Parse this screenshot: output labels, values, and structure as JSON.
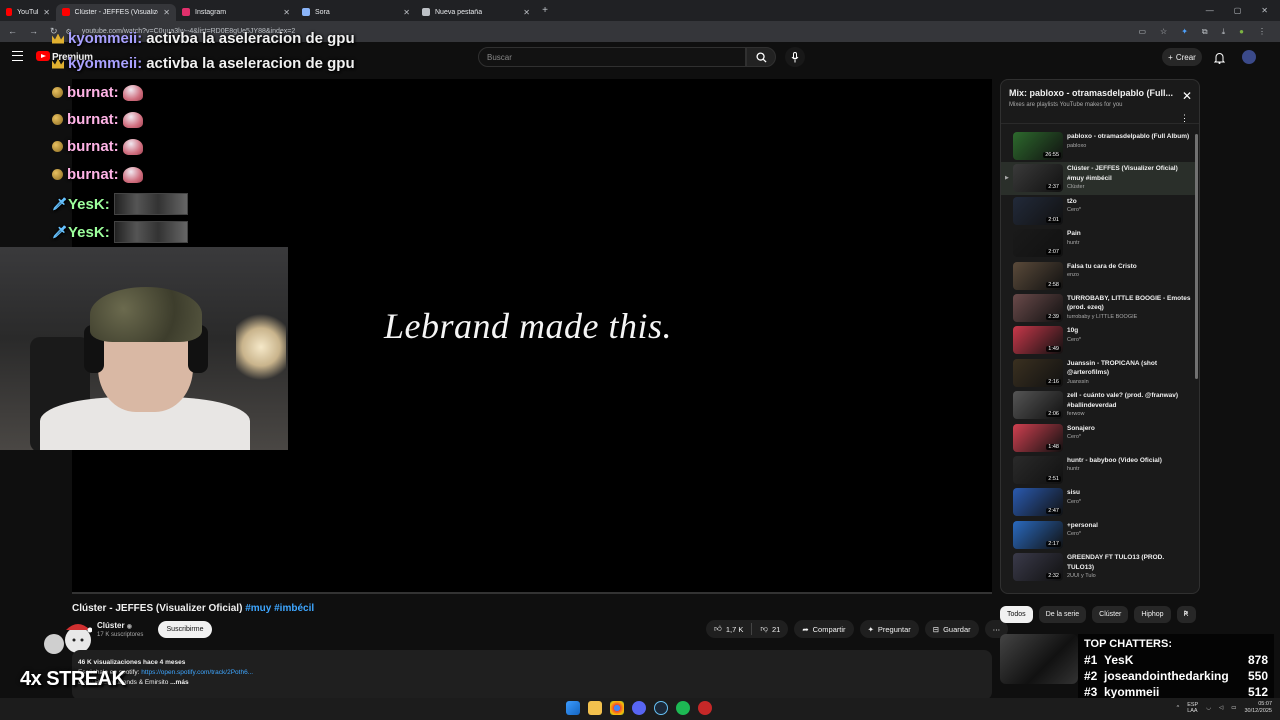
{
  "browser": {
    "tabs": [
      {
        "label": "YouTube",
        "color": "#ff0000",
        "active": false
      },
      {
        "label": "Clúster - JEFFES (Visualizer",
        "color": "#ff0000",
        "active": true
      },
      {
        "label": "Instagram",
        "color": "#e1306c",
        "active": false
      },
      {
        "label": "Sora",
        "color": "#8ab4f8",
        "active": false
      },
      {
        "label": "Nueva pestaña",
        "color": "#bdc1c6",
        "active": false
      }
    ],
    "url": "youtube.com/watch?v=C0uua3lw--4&list=RD0E8gUe5JY88&index=2"
  },
  "header": {
    "brand": "Premium",
    "search_placeholder": "Buscar",
    "create_label": "Crear"
  },
  "player": {
    "overlay_text": "Lebrand made this."
  },
  "chat": [
    {
      "badge": "crown",
      "name": "kyommeii",
      "color": "#a9a1ff",
      "message": "activba la aseleracion de gpu",
      "emote": null
    },
    {
      "badge": "crown",
      "name": "kyommeii",
      "color": "#a9a1ff",
      "message": "activba la aseleracion de gpu",
      "emote": null
    },
    {
      "badge": "coin",
      "name": "burnat",
      "color": "#ffb3e6",
      "message": "",
      "emote": "mushroom"
    },
    {
      "badge": "coin",
      "name": "burnat",
      "color": "#ffb3e6",
      "message": "",
      "emote": "mushroom"
    },
    {
      "badge": "coin",
      "name": "burnat",
      "color": "#ffb3e6",
      "message": "",
      "emote": "mushroom"
    },
    {
      "badge": "coin",
      "name": "burnat",
      "color": "#ffb3e6",
      "message": "",
      "emote": "mushroom"
    },
    {
      "badge": "sword",
      "name": "YesK",
      "color": "#9cff9c",
      "message": "",
      "emote": "image"
    },
    {
      "badge": "sword",
      "name": "YesK",
      "color": "#9cff9c",
      "message": "",
      "emote": "image"
    }
  ],
  "playlist": {
    "title": "Mix: pabloxo - otramasdelpablo (Full...",
    "subtitle": "Mixes are playlists YouTube makes for you",
    "items": [
      {
        "title": "pabloxo - otramasdelpablo (Full Album)",
        "artist": "pabloxo",
        "duration": "26:55",
        "active": false,
        "thumb": "#2d6a2d"
      },
      {
        "title": "Clúster - JEFFES (Visualizer Oficial) #muy #imbécil",
        "artist": "Clúster",
        "duration": "2:37",
        "active": true,
        "thumb": "#3a3a3a"
      },
      {
        "title": "t2o",
        "artist": "Cero*",
        "duration": "2:01",
        "active": false,
        "thumb": "#222a3a"
      },
      {
        "title": "Pain",
        "artist": "huntr",
        "duration": "2:07",
        "active": false,
        "thumb": "#1a1a1a"
      },
      {
        "title": "Falsa tu cara de Cristo",
        "artist": "enzo",
        "duration": "2:58",
        "active": false,
        "thumb": "#5a4a3a"
      },
      {
        "title": "TURROBABY, LITTLE BOOGIE - Emotes (prod. ezeq)",
        "artist": "turrobaby y LITTLE BOOGIE",
        "duration": "2:39",
        "active": false,
        "thumb": "#6a4a4a"
      },
      {
        "title": "10g",
        "artist": "Cero*",
        "duration": "1:49",
        "active": false,
        "thumb": "#c8384a"
      },
      {
        "title": "Juanssin - TROPICANA (shot @arterofilms)",
        "artist": "Juanssin",
        "duration": "2:16",
        "active": false,
        "thumb": "#3a3020"
      },
      {
        "title": "zell - cuánto vale? (prod. @franwav) #ballindeverdad",
        "artist": "ferwow",
        "duration": "2:06",
        "active": false,
        "thumb": "#555555"
      },
      {
        "title": "Sonajero",
        "artist": "Cero*",
        "duration": "1:48",
        "active": false,
        "thumb": "#d04050"
      },
      {
        "title": "huntr - babyboo (Video Oficial)",
        "artist": "huntr",
        "duration": "2:51",
        "active": false,
        "thumb": "#2a2a2a"
      },
      {
        "title": "sisu",
        "artist": "Cero*",
        "duration": "2:47",
        "active": false,
        "thumb": "#2a5ab0"
      },
      {
        "title": "+personal",
        "artist": "Cero*",
        "duration": "2:17",
        "active": false,
        "thumb": "#2a6ac0"
      },
      {
        "title": "GREENDAY FT TULO13 (PROD. TULO13)",
        "artist": "2UUI y Tulo",
        "duration": "2:32",
        "active": false,
        "thumb": "#3a3a4a"
      }
    ]
  },
  "video": {
    "title_main": "Clúster - JEFFES (Visualizer Oficial) ",
    "title_tags": "#muy #imbécil",
    "channel": "Clúster",
    "subs": "17 K suscriptores",
    "subscribe_label": "Suscribirme",
    "likes": "1,7 K",
    "dislikes": "21",
    "share_label": "Compartir",
    "ask_label": "Preguntar",
    "save_label": "Guardar",
    "views": "46 K visualizaciones  hace 4 meses",
    "desc_prefix": "Escúchalo en spotify: ",
    "desc_link": "https://open.spotify.com/track/2Poth6...",
    "desc_line2": "Beat: Rxcardobands & Emirsito",
    "more_label": "...más"
  },
  "chips": [
    "Todos",
    "De la serie",
    "Clúster",
    "Hiphop",
    "R"
  ],
  "streak": "4x STREAK",
  "top_chatters": {
    "title": "TOP CHATTERS:",
    "rows": [
      {
        "rank": "#1",
        "name": "YesK",
        "count": "878"
      },
      {
        "rank": "#2",
        "name": "joseandointhedarking",
        "count": "550"
      },
      {
        "rank": "#3",
        "name": "kyommeii",
        "count": "512"
      }
    ]
  },
  "taskbar": {
    "lang": "ESP\nLAA",
    "time": "05:07",
    "date": "30/12/2025"
  }
}
